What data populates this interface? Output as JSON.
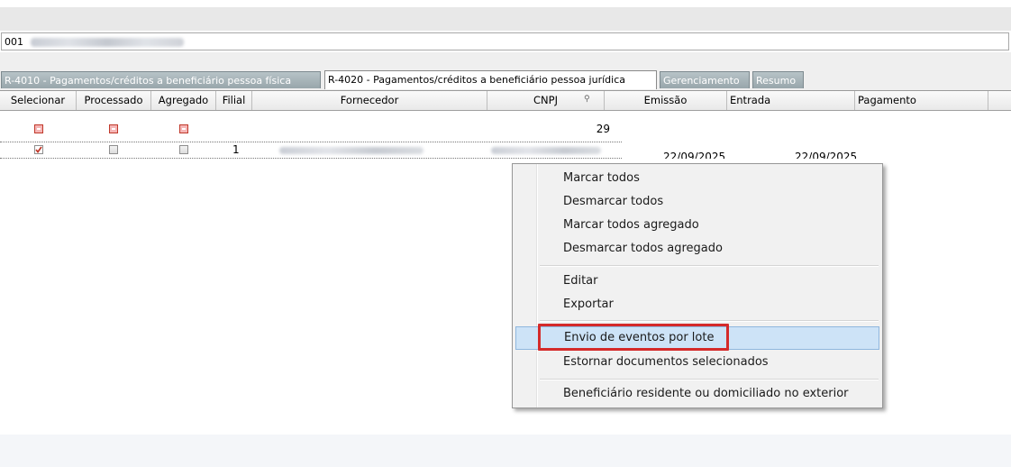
{
  "company": {
    "code": "001"
  },
  "tabs": [
    {
      "label": "R-4010 - Pagamentos/créditos a beneficiário pessoa física",
      "active": false
    },
    {
      "label": "R-4020 - Pagamentos/créditos a beneficiário pessoa jurídica",
      "active": true
    },
    {
      "label": "Gerenciamento",
      "active": false
    },
    {
      "label": "Resumo",
      "active": false
    }
  ],
  "grid": {
    "columns": [
      "Selecionar",
      "Processado",
      "Agregado",
      "Filial",
      "Fornecedor",
      "CNPJ",
      "Emissão",
      "Entrada",
      "Pagamento"
    ],
    "filter_row": {
      "cnpj_count": "29"
    },
    "rows": [
      {
        "selecionar": true,
        "processado": false,
        "agregado": false,
        "filial": "1",
        "emissao": "22/09/2025",
        "entrada": "22/09/2025"
      }
    ]
  },
  "context_menu": {
    "items": [
      "Marcar todos",
      "Desmarcar todos",
      "Marcar todos agregado",
      "Desmarcar todos agregado",
      "Editar",
      "Exportar",
      "Envio de eventos por lote",
      "Estornar documentos selecionados",
      "Beneficiário residente ou domiciliado no exterior"
    ],
    "highlighted": "Envio de eventos por lote"
  },
  "colors": {
    "tab_inactive": "#98a6ab",
    "menu_highlight": "#cde3f7",
    "annotation_red": "#d42a2a"
  }
}
